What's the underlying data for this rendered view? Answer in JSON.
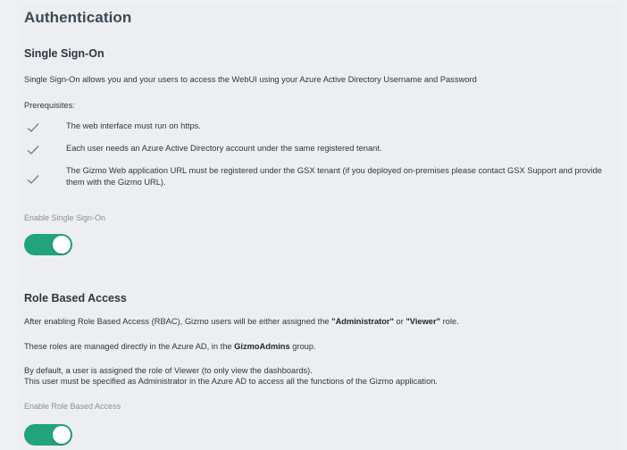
{
  "page": {
    "title": "Authentication"
  },
  "sso": {
    "title": "Single Sign-On",
    "description": "Single Sign-On allows you and your users to access the WebUI using your Azure Active Directory Username and Password",
    "prerequisites_label": "Prerequisites:",
    "prerequisites": [
      "The web interface must run on https.",
      "Each user needs an Azure Active Directory account under the same registered tenant.",
      "The Gizmo Web application URL must be registered under the GSX tenant (if you deployed on-premises please contact GSX Support and provide them with the Gizmo URL)."
    ],
    "toggle_label": "Enable Single Sign-On",
    "enabled": true
  },
  "rbac": {
    "title": "Role Based Access",
    "line1_pre": "After enabling Role Based Access (RBAC), Gizmo users will be either assigned the ",
    "line1_role1": "\"Administrator\"",
    "line1_mid": " or ",
    "line1_role2": "\"Viewer\"",
    "line1_post": " role.",
    "line2_pre": "These roles are managed directly in the Azure AD, in the ",
    "line2_group": "GizmoAdmins",
    "line2_post": " group.",
    "line3": "By default, a user is assigned the role of Viewer (to only view the dashboards).",
    "line4": "This user must be specified as Administrator in the Azure AD to access all the functions of the Gizmo application.",
    "toggle_label": "Enable Role Based Access",
    "enabled": true
  },
  "colors": {
    "toggle_on": "#23a37d",
    "check": "#5a6670"
  },
  "icons": {
    "check": "check-icon"
  }
}
